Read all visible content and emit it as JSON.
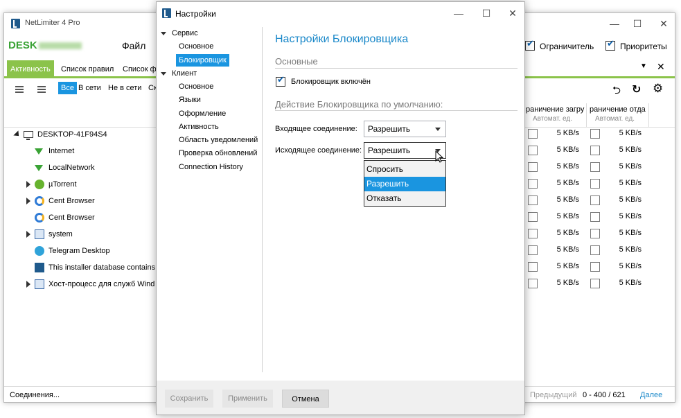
{
  "main": {
    "title": "NetLimiter 4 Pro",
    "host_label": "DESK",
    "menu": [
      "Файл"
    ],
    "toggles": {
      "limiter": "Ограничитель",
      "priorities": "Приоритеты"
    },
    "tabs": [
      "Активность",
      "Список правил",
      "Список ф"
    ],
    "filters": [
      "Все",
      "В сети",
      "Не в сети",
      "Ск"
    ],
    "columns": {
      "limit_in": "раничение загру",
      "limit_out": "раничение отда",
      "sub": "Автомат. ед."
    },
    "tree": [
      {
        "label": "DESKTOP-41F94S4",
        "icon": "computer-icon"
      },
      {
        "label": "Internet",
        "icon": "filter-icon"
      },
      {
        "label": "LocalNetwork",
        "icon": "filter-icon"
      },
      {
        "label": "µTorrent",
        "icon": "utorrent-icon"
      },
      {
        "label": "Cent Browser",
        "icon": "cent-browser-icon"
      },
      {
        "label": "Cent Browser",
        "icon": "cent-browser-icon"
      },
      {
        "label": "system",
        "icon": "system-icon"
      },
      {
        "label": "Telegram Desktop",
        "icon": "telegram-icon"
      },
      {
        "label": "This installer database contains",
        "icon": "netlimiter-icon"
      },
      {
        "label": "Хост-процесс для служб Wind",
        "icon": "system-icon"
      }
    ],
    "rate": "5 KB/s",
    "status": {
      "left": "Соединения...",
      "prev": "Предыдущий",
      "range": "0 - 400 / 621",
      "next": "Далее"
    }
  },
  "dialog": {
    "title": "Настройки",
    "nav": {
      "service": "Сервис",
      "service_items": [
        "Основное",
        "Блокировщик"
      ],
      "client": "Клиент",
      "client_items": [
        "Основное",
        "Языки",
        "Оформление",
        "Активность",
        "Область уведомлений",
        "Проверка обновлений",
        "Connection History"
      ]
    },
    "heading": "Настройки Блокировщика",
    "section_basic": "Основные",
    "blocker_enabled": "Блокировщик включён",
    "section_default": "Действие Блокировщика по умолчанию:",
    "incoming_label": "Входящее соединение:",
    "incoming_value": "Разрешить",
    "outgoing_label": "Исходящее соединение:",
    "outgoing_value": "Разрешить",
    "dropdown_options": [
      "Спросить",
      "Разрешить",
      "Отказать"
    ],
    "buttons": {
      "save": "Сохранить",
      "apply": "Применить",
      "cancel": "Отмена"
    }
  },
  "colors": {
    "accent_green": "#8bc34a",
    "accent_blue": "#1a95e0",
    "heading_blue": "#1a88c9"
  }
}
